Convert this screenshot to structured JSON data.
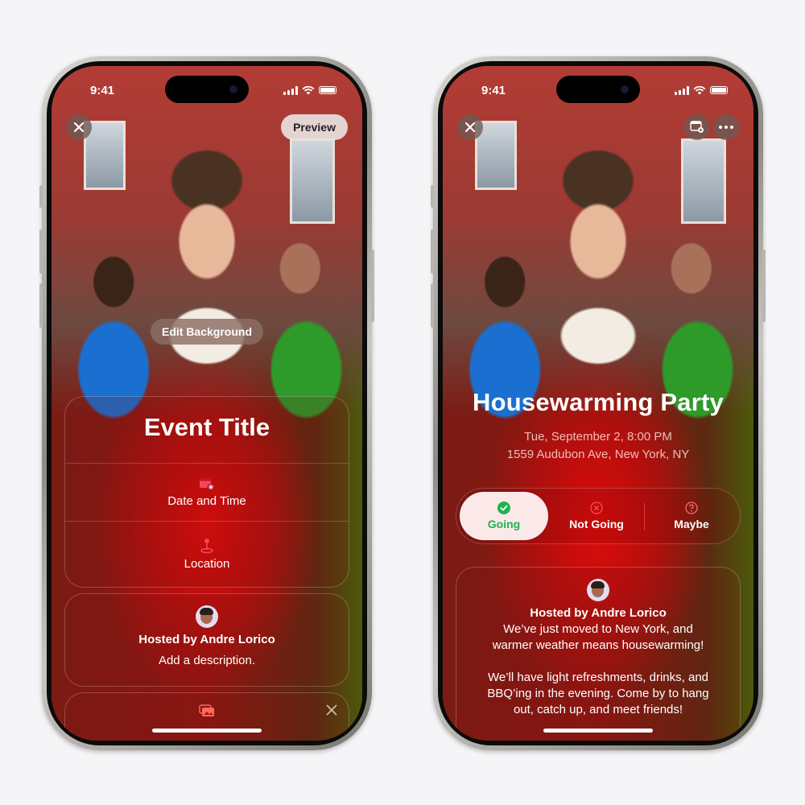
{
  "status_bar": {
    "time": "9:41"
  },
  "left_phone": {
    "close_icon": "close-icon",
    "preview_label": "Preview",
    "edit_background_label": "Edit Background",
    "event_title": "Event Title",
    "rows": [
      {
        "icon": "calendar-add-icon",
        "label": "Date and Time"
      },
      {
        "icon": "location-pin-icon",
        "label": "Location"
      }
    ],
    "host": {
      "avatar": "memoji-avatar",
      "hosted_by": "Hosted by Andre Lorico",
      "description": "Add a description."
    },
    "photos_card": {
      "icon": "photos-icon",
      "dismiss_icon": "close-icon"
    }
  },
  "right_phone": {
    "close_icon": "close-icon",
    "toolbar_icons": [
      "calendar-add-icon",
      "more-icon"
    ],
    "event_title": "Housewarming Party",
    "date_time": "Tue, September 2, 8:00 PM",
    "location": "1559 Audubon Ave, New York, NY",
    "rsvp": {
      "selected": "Going",
      "options": [
        {
          "label": "Going",
          "icon": "checkmark-circle-icon"
        },
        {
          "label": "Not Going",
          "icon": "x-circle-icon"
        },
        {
          "label": "Maybe",
          "icon": "question-circle-icon"
        }
      ]
    },
    "host": {
      "hosted_by": "Hosted by Andre Lorico",
      "description_p1_l1": "We’ve just moved to New York, and",
      "description_p1_l2": "warmer weather means housewarming!",
      "description_p2_l1": "We’ll have light refreshments, drinks, and",
      "description_p2_l2": "BBQ’ing in the evening. Come by to hang",
      "description_p2_l3": "out, catch up, and meet friends!"
    }
  },
  "colors": {
    "accent_red": "#e0102a",
    "going_green": "#1eb34a",
    "selected_pill": "#fbe9ea"
  }
}
